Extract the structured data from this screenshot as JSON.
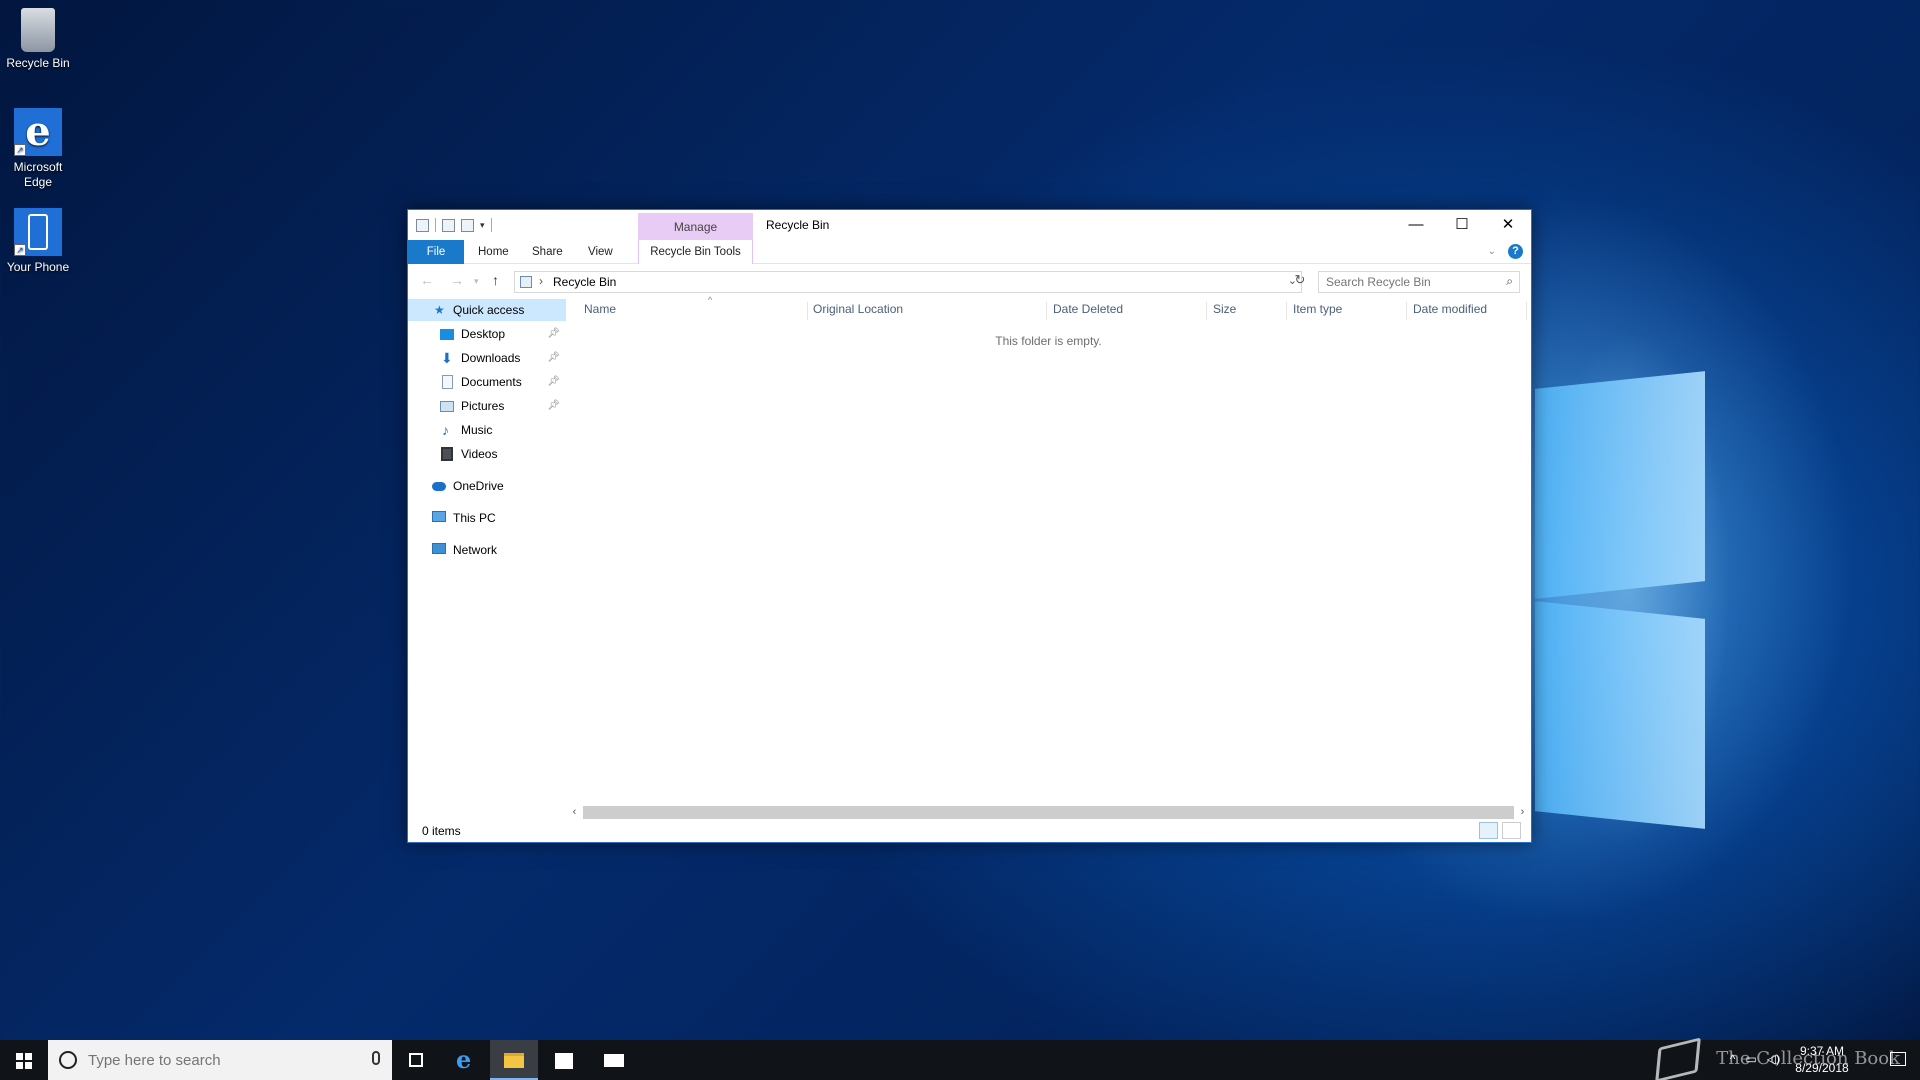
{
  "desktop": {
    "icons": [
      {
        "label": "Recycle Bin"
      },
      {
        "label": "Microsoft Edge"
      },
      {
        "label": "Your Phone"
      }
    ]
  },
  "window": {
    "title": "Recycle Bin",
    "context_tab_group": "Manage",
    "caption": {
      "minimize": "—",
      "maximize": "☐",
      "close": "✕"
    },
    "ribbon_tabs": [
      "File",
      "Home",
      "Share",
      "View",
      "Recycle Bin Tools"
    ],
    "address": {
      "path": "Recycle Bin",
      "separator": "›"
    },
    "search": {
      "placeholder": "Search Recycle Bin"
    },
    "nav_pane": {
      "quick_access": "Quick access",
      "items": [
        {
          "label": "Desktop",
          "pinned": true
        },
        {
          "label": "Downloads",
          "pinned": true
        },
        {
          "label": "Documents",
          "pinned": true
        },
        {
          "label": "Pictures",
          "pinned": true
        },
        {
          "label": "Music",
          "pinned": false
        },
        {
          "label": "Videos",
          "pinned": false
        }
      ],
      "onedrive": "OneDrive",
      "this_pc": "This PC",
      "network": "Network"
    },
    "columns": [
      "Name",
      "Original Location",
      "Date Deleted",
      "Size",
      "Item type",
      "Date modified"
    ],
    "empty_message": "This folder is empty.",
    "status": "0 items"
  },
  "taskbar": {
    "search_placeholder": "Type here to search",
    "clock": {
      "time": "9:37 AM",
      "date": "8/29/2018"
    },
    "watermark": "The Collection Book"
  },
  "colors": {
    "accent": "#1979ca",
    "manage_tab": "#e9ccf5",
    "selection": "#cce8ff"
  }
}
